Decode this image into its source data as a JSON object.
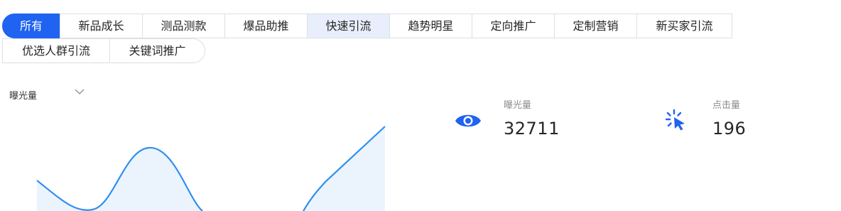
{
  "tabs_row1": [
    "所有",
    "新品成长",
    "测品测款",
    "爆品助推",
    "快速引流",
    "趋势明星",
    "定向推广",
    "定制营销",
    "新买家引流"
  ],
  "tabs_row2": [
    "优选人群引流",
    "关键词推广"
  ],
  "active_tab": "所有",
  "metric_select": {
    "value": "曝光量"
  },
  "stats": {
    "impressions": {
      "label": "曝光量",
      "value": "32711",
      "icon": "eye-icon"
    },
    "clicks": {
      "label": "点击量",
      "value": "196",
      "icon": "click-icon"
    }
  },
  "colors": {
    "accent": "#1f63f0",
    "line": "#2f8ff0",
    "area": "#e9f3fd"
  }
}
